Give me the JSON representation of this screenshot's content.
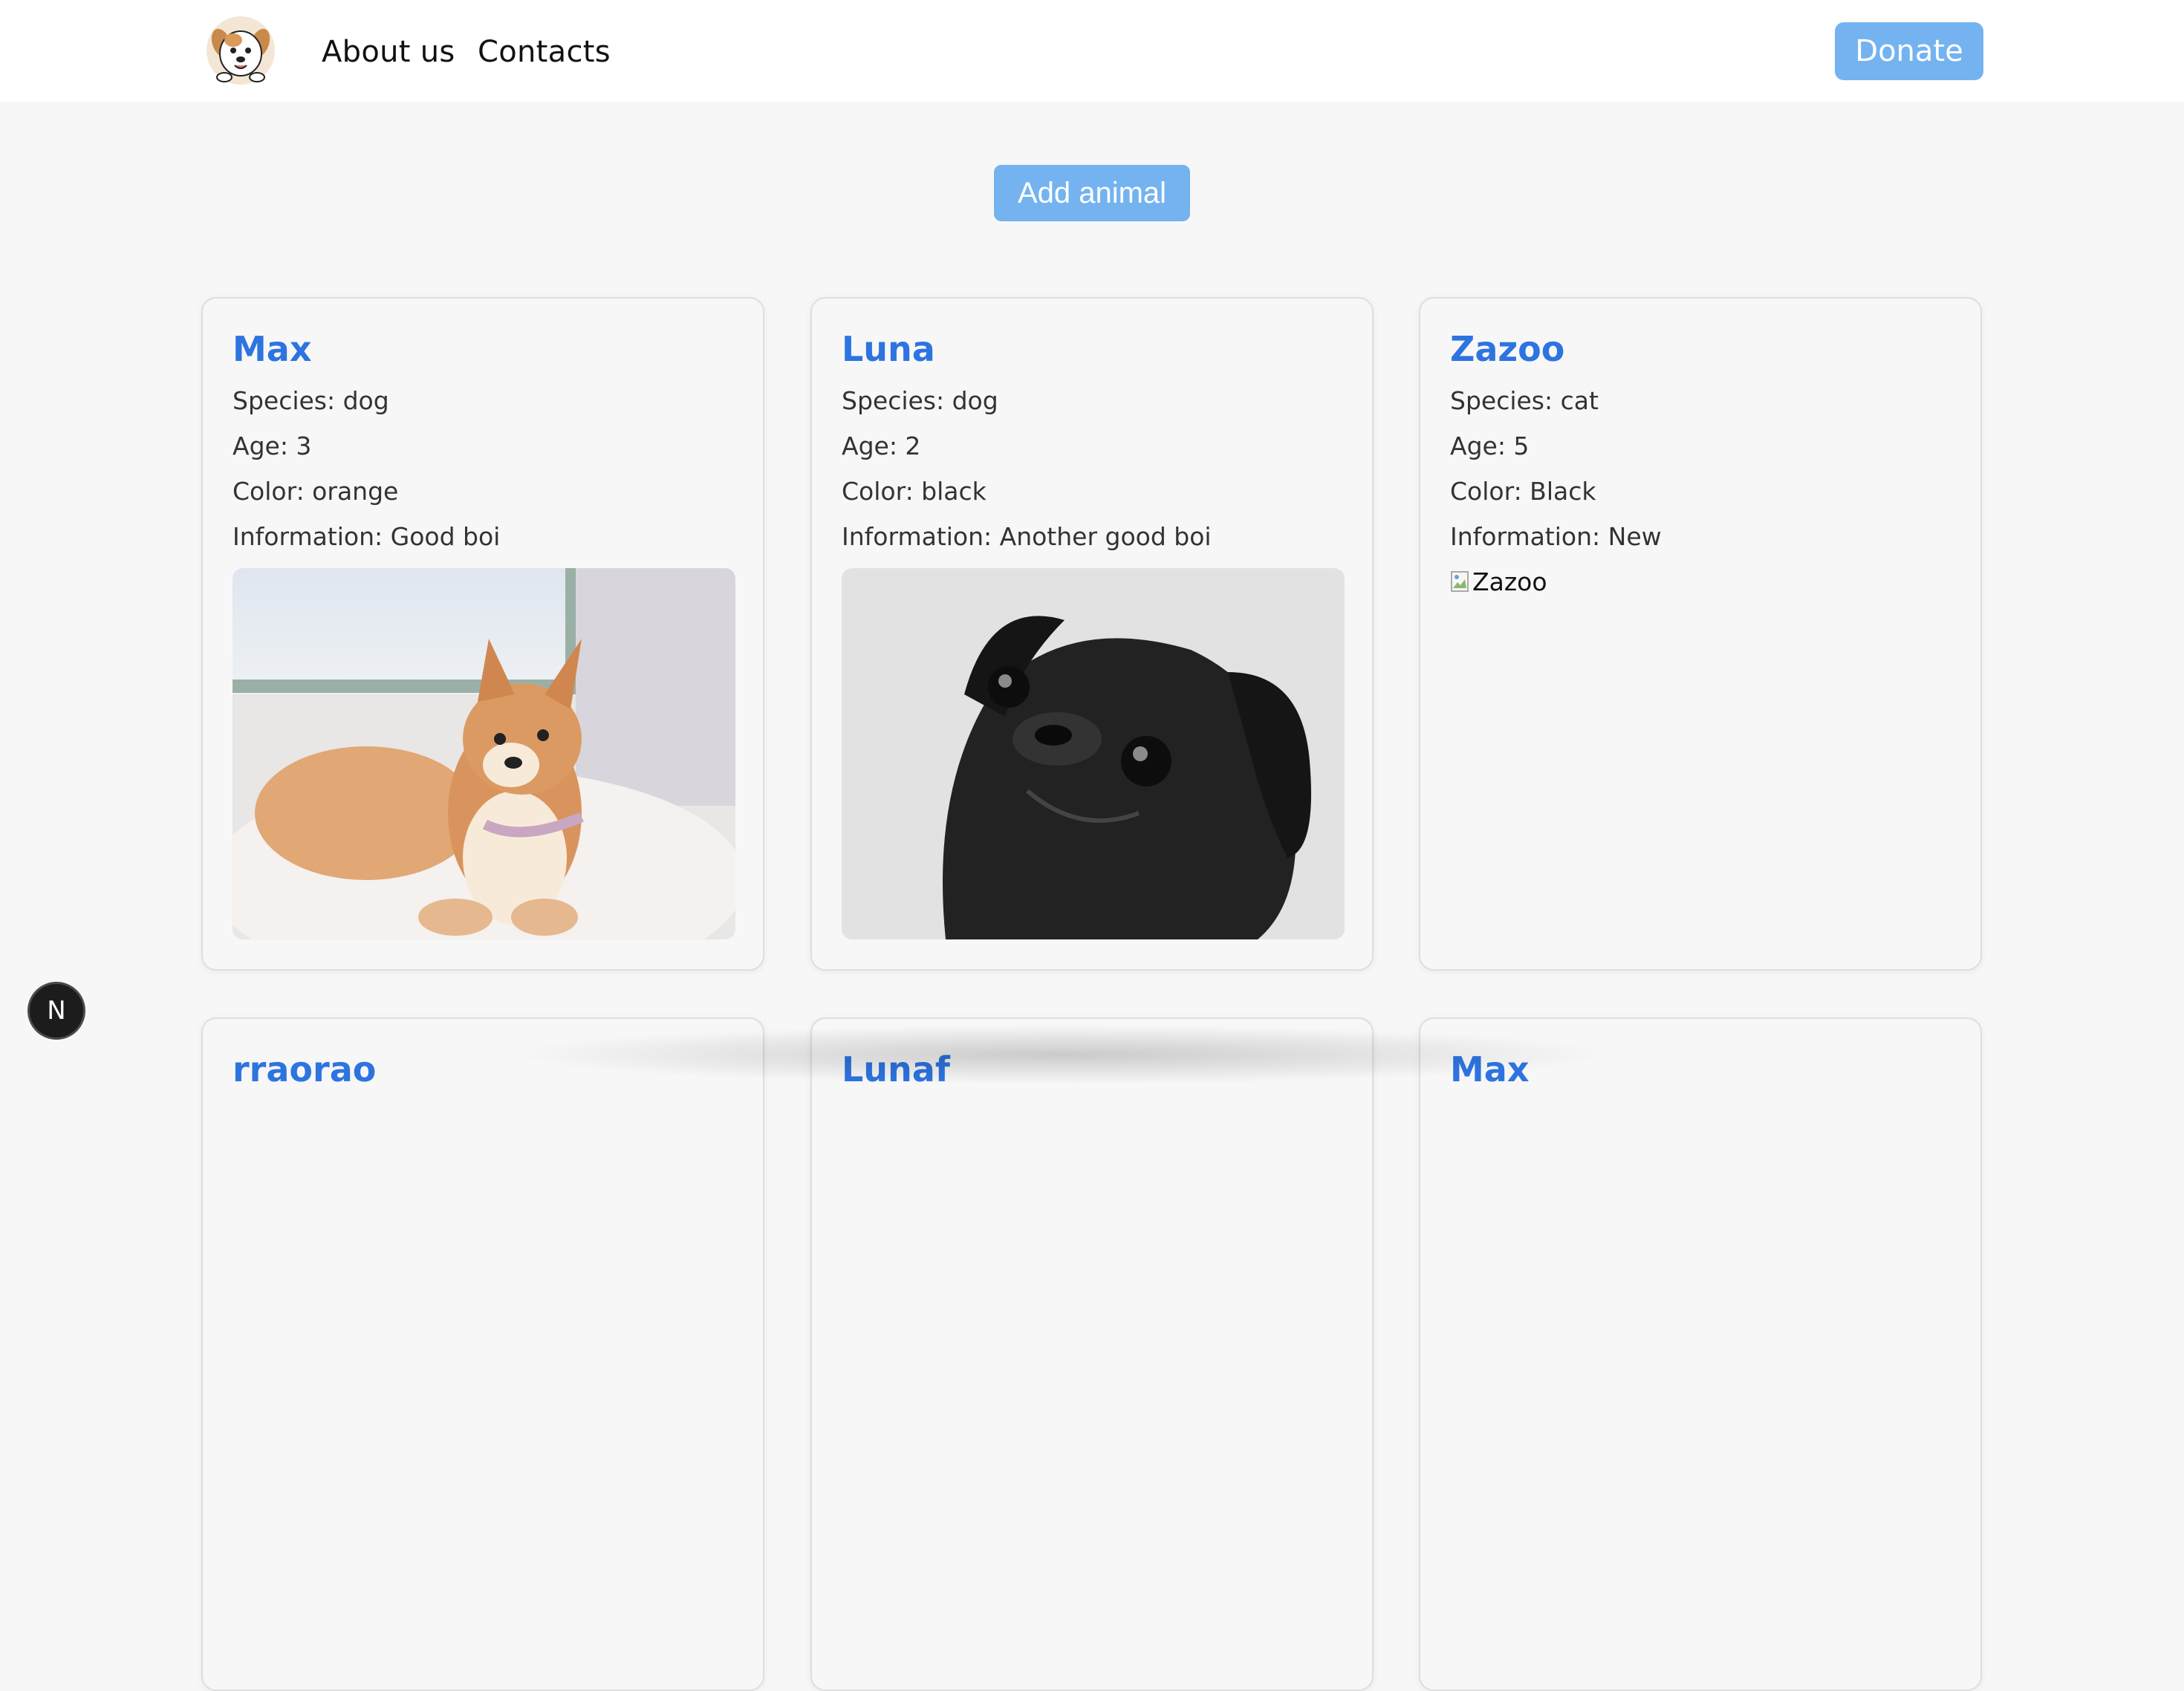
{
  "header": {
    "logo_icon": "puppy-logo-icon",
    "nav": [
      {
        "label": "About us"
      },
      {
        "label": "Contacts"
      }
    ],
    "donate_label": "Donate"
  },
  "actions": {
    "add_animal_label": "Add animal"
  },
  "colors": {
    "accent": "#74b3f0",
    "name_blue": "#2d74e0",
    "page_bg": "#f7f7f7"
  },
  "cards": [
    {
      "name": "Max",
      "species": "Species: dog",
      "age": "Age: 3",
      "color": "Color: orange",
      "information": "Information: Good boi",
      "photo": "shiba-puppy-photo"
    },
    {
      "name": "Luna",
      "species": "Species: dog",
      "age": "Age: 2",
      "color": "Color: black",
      "information": "Information: Another good boi",
      "photo": "black-pug-photo"
    },
    {
      "name": "Zazoo",
      "species": "Species: cat",
      "age": "Age: 5",
      "color": "Color: Black",
      "information": "Information: New",
      "photo_alt": "Zazoo"
    }
  ],
  "next_row": [
    {
      "name": "rraorao"
    },
    {
      "name": "Lunaf"
    },
    {
      "name": "Max"
    }
  ],
  "dev_badge": {
    "label": "N"
  }
}
